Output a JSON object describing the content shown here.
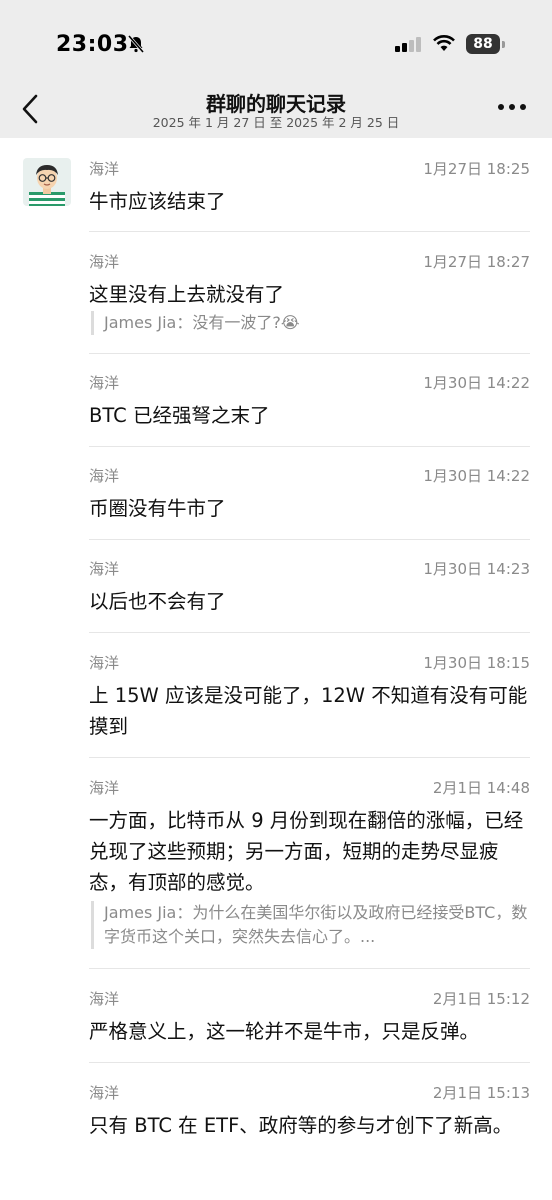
{
  "status_bar": {
    "time": "23:03",
    "battery": "88"
  },
  "header": {
    "title": "群聊的聊天记录",
    "subtitle": "2025 年 1 月 27 日 至 2025 年 2 月 25 日"
  },
  "messages": [
    {
      "sender": "海洋",
      "time": "1月27日 18:25",
      "text": "牛市应该结束了"
    },
    {
      "sender": "海洋",
      "time": "1月27日 18:27",
      "text": "这里没有上去就没有了",
      "quote": "James Jia：没有一波了?😭"
    },
    {
      "sender": "海洋",
      "time": "1月30日 14:22",
      "text": "BTC 已经强弩之末了"
    },
    {
      "sender": "海洋",
      "time": "1月30日 14:22",
      "text": "币圈没有牛市了"
    },
    {
      "sender": "海洋",
      "time": "1月30日 14:23",
      "text": "以后也不会有了"
    },
    {
      "sender": "海洋",
      "time": "1月30日 18:15",
      "text": "上 15W 应该是没可能了，12W 不知道有没有可能摸到"
    },
    {
      "sender": "海洋",
      "time": "2月1日 14:48",
      "text": "一方面，比特币从 9 月份到现在翻倍的涨幅，已经兑现了这些预期；另一方面，短期的走势尽显疲态，有顶部的感觉。",
      "quote": "James Jia：为什么在美国华尔街以及政府已经接受BTC，数字货币这个关口，突然失去信心了。..."
    },
    {
      "sender": "海洋",
      "time": "2月1日 15:12",
      "text": "严格意义上，这一轮并不是牛市，只是反弹。"
    },
    {
      "sender": "海洋",
      "time": "2月1日 15:13",
      "text": "只有 BTC 在 ETF、政府等的参与才创下了新高。"
    }
  ]
}
